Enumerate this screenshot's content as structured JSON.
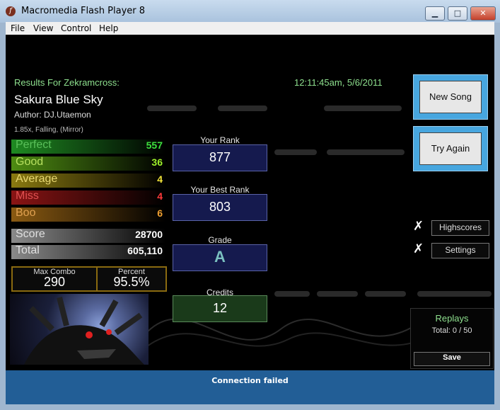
{
  "window": {
    "title": "Macromedia Flash Player 8",
    "icon_glyph": "f",
    "minimize_glyph": "▁",
    "maximize_glyph": "□",
    "close_glyph": "✕"
  },
  "menu": [
    "File",
    "View",
    "Control",
    "Help"
  ],
  "results": {
    "header": "Results For Zekramcross:",
    "timestamp": "12:11:45am, 5/6/2011",
    "song_title": "Sakura Blue Sky",
    "author": "Author: DJ.Utaemon",
    "options": "1.85x, Falling, (Mirror)"
  },
  "judgements": [
    {
      "label": "Perfect",
      "value": "557",
      "color": "#1f8a22",
      "value_color": "#3ee03e"
    },
    {
      "label": "Good",
      "value": "36",
      "color": "#4e8c12",
      "value_color": "#9ef02a"
    },
    {
      "label": "Average",
      "value": "4",
      "color": "#8a7a10",
      "value_color": "#f2e43a"
    },
    {
      "label": "Miss",
      "value": "4",
      "color": "#8a1414",
      "value_color": "#ff3a3a"
    },
    {
      "label": "Boo",
      "value": "6",
      "color": "#8a5a12",
      "value_color": "#f0a030"
    }
  ],
  "totals": [
    {
      "label": "Score",
      "value": "28700"
    },
    {
      "label": "Total",
      "value": "605,110"
    }
  ],
  "combo": {
    "label": "Max Combo",
    "value": "290"
  },
  "percent": {
    "label": "Percent",
    "value": "95.5%"
  },
  "ranks": [
    {
      "label": "Your Rank",
      "value": "877"
    },
    {
      "label": "Your Best Rank",
      "value": "803"
    },
    {
      "label": "Grade",
      "value": "A"
    },
    {
      "label": "Credits",
      "value": "12"
    }
  ],
  "buttons": {
    "new_song": "New Song",
    "try_again": "Try Again",
    "highscores": "Highscores",
    "settings": "Settings",
    "save": "Save"
  },
  "replays": {
    "title": "Replays",
    "total": "Total: 0 / 50"
  },
  "status": "Connection failed",
  "colors": {
    "accent_blue": "#47a6df",
    "status_bar": "#225e96",
    "rank_box": "#151a4e",
    "credits_box": "#1a3a1a"
  }
}
